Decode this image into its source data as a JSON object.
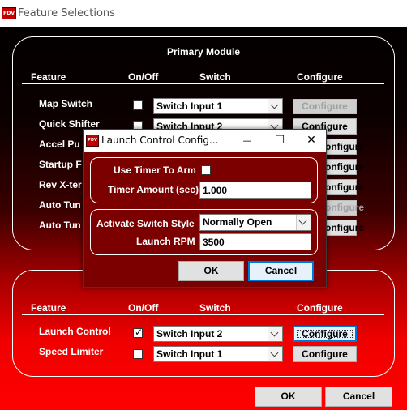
{
  "window": {
    "title": "Feature Selections",
    "icon": "pdv-logo-icon",
    "icon_text": "PDV"
  },
  "primary": {
    "title": "Primary Module",
    "headers": {
      "feature": "Feature",
      "onoff": "On/Off",
      "switch": "Switch",
      "configure": "Configure"
    },
    "rows": [
      {
        "label": "Map Switch",
        "checked": false,
        "switch": "Switch Input 1",
        "configure": "Configure",
        "configure_enabled": false
      },
      {
        "label": "Quick Shifter",
        "checked": false,
        "switch": "Switch Input 2",
        "configure": "Configure",
        "configure_enabled": true
      },
      {
        "label": "Accel Pu",
        "configure": "onfigure",
        "configure_enabled": true
      },
      {
        "label": "Startup F",
        "configure": "onfigure",
        "configure_enabled": true
      },
      {
        "label": "Rev X-ter",
        "configure": "onfigure",
        "configure_enabled": true
      },
      {
        "label": "Auto Tun",
        "configure": "onfigure",
        "configure_enabled": false
      },
      {
        "label": "Auto Tun",
        "configure": "onfigure",
        "configure_enabled": true
      }
    ]
  },
  "secondary": {
    "headers": {
      "feature": "Feature",
      "onoff": "On/Off",
      "switch": "Switch",
      "configure": "Configure"
    },
    "rows": [
      {
        "label": "Launch Control",
        "checked": true,
        "check_mark": "✓",
        "switch": "Switch Input 2",
        "configure": "Configure",
        "configure_enabled": true
      },
      {
        "label": "Speed Limiter",
        "checked": false,
        "switch": "Switch Input 1",
        "configure": "Configure",
        "configure_enabled": true
      }
    ]
  },
  "footer": {
    "ok_label": "OK",
    "cancel_label": "Cancel"
  },
  "dialog": {
    "title": "Launch Control Config...",
    "controls": {
      "minimize": "—",
      "maximize": "☐",
      "close": "✕"
    },
    "timer": {
      "use_timer_label": "Use Timer To Arm",
      "use_timer_checked": false,
      "timer_amount_label": "Timer Amount (sec)",
      "timer_amount_value": "1.000"
    },
    "activation": {
      "switch_style_label": "Activate Switch Style",
      "switch_style_value": "Normally Open",
      "rpm_label": "Launch RPM",
      "rpm_value": "3500"
    },
    "ok_label": "OK",
    "cancel_label": "Cancel"
  },
  "colors": {
    "accent": "#0078d7",
    "bg_top": "#000000",
    "bg_bottom": "#ff0000"
  }
}
